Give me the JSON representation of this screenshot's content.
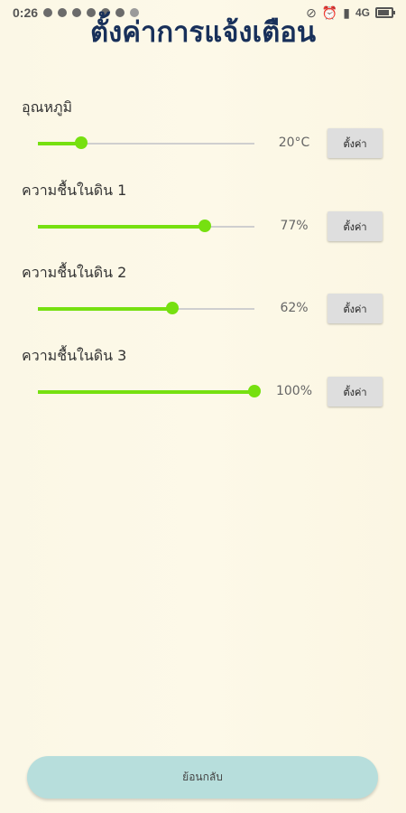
{
  "status_bar": {
    "time": "0:26",
    "network": "4G",
    "notification_icons": [
      "facebook-icon",
      "messenger-icon",
      "chat-icon",
      "chat-icon",
      "chat-icon",
      "chat-icon",
      "circle-icon"
    ],
    "right_icons": [
      "mute-icon",
      "alarm-icon",
      "signal-icon",
      "battery-icon"
    ]
  },
  "page": {
    "title": "ตั้งค่าการแจ้งเตือน"
  },
  "settings": [
    {
      "label": "อุณหภูมิ",
      "value_text": "20°C",
      "slider_fraction": 0.2,
      "button_label": "ตั้งค่า"
    },
    {
      "label": "ความชื้นในดิน 1",
      "value_text": "77%",
      "slider_fraction": 0.77,
      "button_label": "ตั้งค่า"
    },
    {
      "label": "ความชื้นในดิน 2",
      "value_text": "62%",
      "slider_fraction": 0.62,
      "button_label": "ตั้งค่า"
    },
    {
      "label": "ความชื้นในดิน 3",
      "value_text": "100%",
      "slider_fraction": 1.0,
      "button_label": "ตั้งค่า"
    }
  ],
  "back_button": {
    "label": "ย้อนกลับ"
  },
  "colors": {
    "slider_accent": "#76e010",
    "title": "#18305a",
    "back_button_bg": "#b7dedc"
  }
}
